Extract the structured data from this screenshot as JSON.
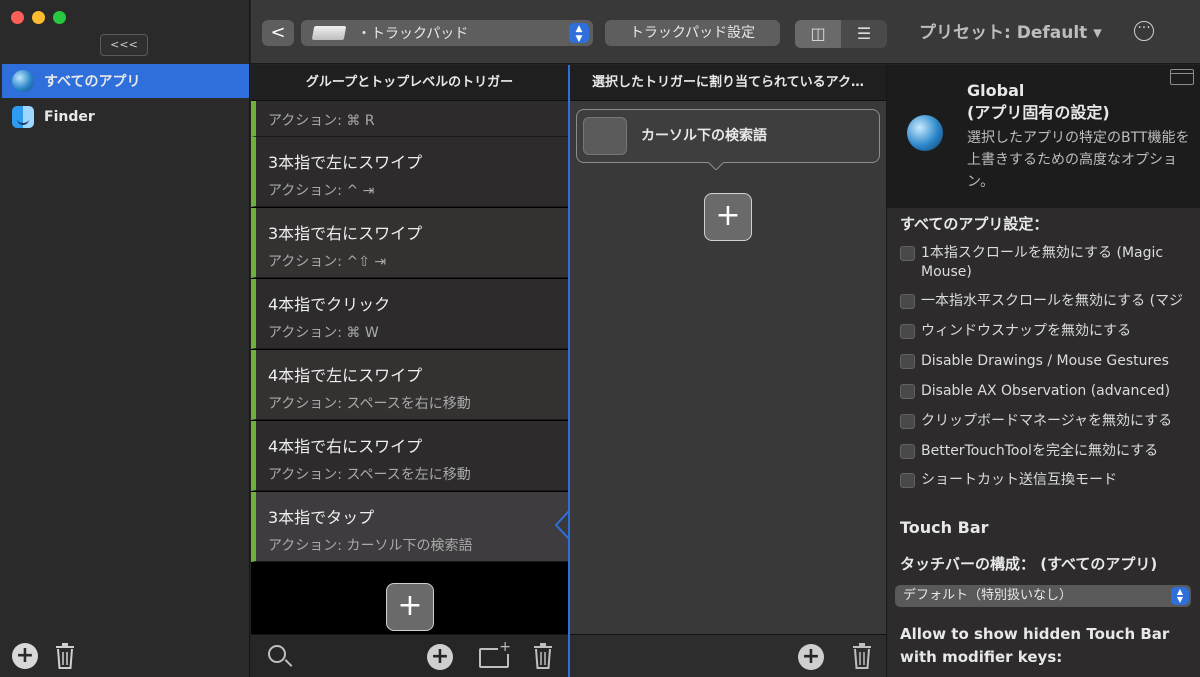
{
  "sidebar": {
    "collapse_label": "<<<",
    "apps": [
      {
        "label": "すべてのアプリ",
        "icon": "globe-icon"
      },
      {
        "label": "Finder",
        "icon": "finder-icon"
      }
    ]
  },
  "toolbar": {
    "back_label": "<",
    "trigger_type": "・トラックパッド",
    "trackpad_settings": "トラックパッド設定",
    "preset_label": "プリセット: Default ▾"
  },
  "triggers": {
    "header": "グループとトップレベルのトリガー",
    "items": [
      {
        "title": "",
        "action": "アクション: ⌘ R"
      },
      {
        "title": "3本指で左にスワイプ",
        "action": "アクション: ^ ⇥"
      },
      {
        "title": "3本指で右にスワイプ",
        "action": "アクション: ^⇧ ⇥"
      },
      {
        "title": "4本指でクリック",
        "action": "アクション: ⌘ W"
      },
      {
        "title": "4本指で左にスワイプ",
        "action": "アクション: スペースを右に移動"
      },
      {
        "title": "4本指で右にスワイプ",
        "action": "アクション: スペースを左に移動"
      },
      {
        "title": "3本指でタップ",
        "action": "アクション: カーソル下の検索語"
      }
    ]
  },
  "actions": {
    "header": "選択したトリガーに割り当てられているアク…",
    "items": [
      {
        "label": "カーソル下の検索語"
      }
    ]
  },
  "details": {
    "title_line1": "Global",
    "title_line2": "(アプリ固有の設定)",
    "description": "選択したアプリの特定のBTT機能を上書きするための高度なオプション。",
    "all_apps_title": "すべてのアプリ設定：",
    "settings": [
      {
        "label": "1本指スクロールを無効にする (Magic Mouse)"
      },
      {
        "label": "一本指水平スクロールを無効にする (マジ"
      },
      {
        "label": "ウィンドウスナップを無効にする"
      },
      {
        "label": "Disable Drawings / Mouse Gestures"
      },
      {
        "label": "Disable AX Observation (advanced)"
      },
      {
        "label": "クリップボードマネージャを無効にする"
      },
      {
        "label": "BetterTouchToolを完全に無効にする"
      },
      {
        "label": "ショートカット送信互換モード"
      }
    ],
    "touchbar_title": "Touch Bar",
    "touchbar_config_label": "タッチバーの構成： (すべてのアプリ)",
    "touchbar_config_value": "デフォルト（特別扱いなし）",
    "touchbar_allow_label": "Allow to show hidden Touch Bar with modifier keys:"
  }
}
